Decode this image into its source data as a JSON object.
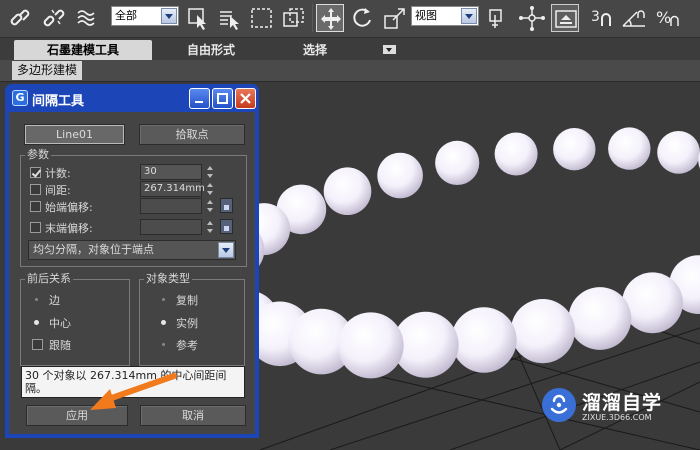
{
  "toolbar": {
    "selection_filter": "全部",
    "reference_coord": "视图",
    "icons": [
      "link-icon",
      "unlink-icon",
      "bind-spacewarp-icon",
      "select-object-icon",
      "select-by-name-icon",
      "rect-selection-icon",
      "window-crossing-icon",
      "move-icon",
      "rotate-icon",
      "scale-icon",
      "pivot-icon",
      "manipulate-icon",
      "snap-3d-icon",
      "angle-snap-icon",
      "percent-snap-icon"
    ]
  },
  "ribbon": {
    "tabs": [
      {
        "label": "石墨建模工具",
        "active": true
      },
      {
        "label": "自由形式",
        "active": false
      },
      {
        "label": "选择",
        "active": false
      }
    ],
    "panel_label": "多边形建模"
  },
  "dialog": {
    "title": "间隔工具",
    "path_button": "Line01",
    "pick_points_button": "拾取点",
    "params": {
      "title": "参数",
      "count_label": "计数:",
      "count_value": "30",
      "count_checked": true,
      "spacing_label": "间距:",
      "spacing_value": "267.314mm",
      "spacing_checked": false,
      "start_offset_label": "始端偏移:",
      "start_offset_value": "",
      "end_offset_label": "末端偏移:",
      "end_offset_value": "",
      "distribution": "均匀分隔，对象位于端点"
    },
    "context": {
      "title": "前后关系",
      "edges_label": "边",
      "centers_label": "中心",
      "follow_label": "跟随",
      "selected": "centers",
      "follow_checked": false
    },
    "object_type": {
      "title": "对象类型",
      "copy_label": "复制",
      "instance_label": "实例",
      "reference_label": "参考",
      "selected": "instance"
    },
    "status_text": "30 个对象以 267.314mm 的中心间距间隔。",
    "apply_button": "应用",
    "cancel_button": "取消"
  },
  "watermark": {
    "brand": "溜溜自学",
    "url": "ZIXUE.3D66.COM"
  },
  "colors": {
    "dialog_title_bar": "#1c46b8",
    "panel_bg": "#444444",
    "annotation_arrow": "#f07a1c",
    "viewport_bg": "#3a3a3a"
  }
}
